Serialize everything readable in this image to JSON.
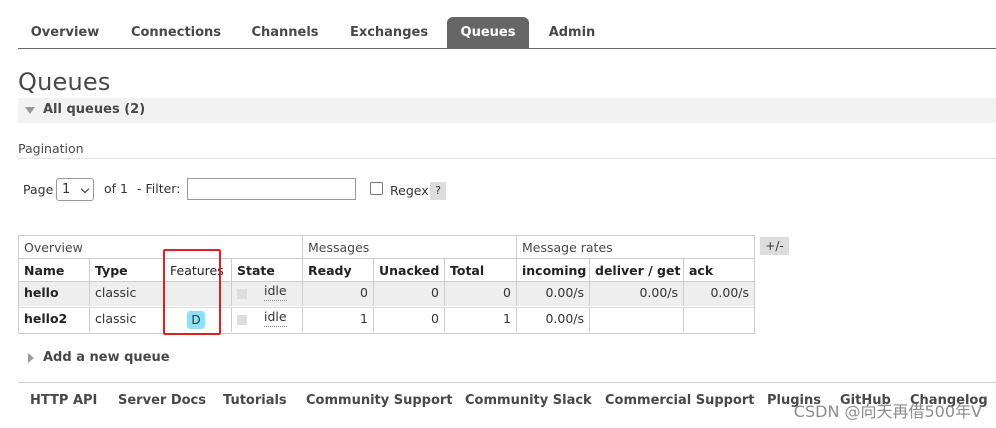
{
  "nav": {
    "tabs": [
      {
        "label": "Overview"
      },
      {
        "label": "Connections"
      },
      {
        "label": "Channels"
      },
      {
        "label": "Exchanges"
      },
      {
        "label": "Queues",
        "active": true
      },
      {
        "label": "Admin"
      }
    ]
  },
  "page": {
    "title": "Queues",
    "section_title": "All queues (2)"
  },
  "pagination": {
    "label": "Pagination",
    "page_label": "Page",
    "page_value": "1",
    "of_label": "of 1",
    "filter_label": "- Filter:",
    "filter_value": "",
    "regex_label": "Regex",
    "help_label": "?"
  },
  "table": {
    "groups": {
      "overview": "Overview",
      "messages": "Messages",
      "rates": "Message rates"
    },
    "columns": {
      "name": "Name",
      "type": "Type",
      "features": "Features",
      "state": "State",
      "ready": "Ready",
      "unacked": "Unacked",
      "total": "Total",
      "incoming": "incoming",
      "deliver_get": "deliver / get",
      "ack": "ack"
    },
    "toggle_label": "+/-",
    "rows": [
      {
        "name": "hello",
        "type": "classic",
        "features": "",
        "state": "idle",
        "ready": "0",
        "unacked": "0",
        "total": "0",
        "incoming": "0.00/s",
        "deliver_get": "0.00/s",
        "ack": "0.00/s"
      },
      {
        "name": "hello2",
        "type": "classic",
        "features": "D",
        "state": "idle",
        "ready": "1",
        "unacked": "0",
        "total": "1",
        "incoming": "0.00/s",
        "deliver_get": "",
        "ack": ""
      }
    ]
  },
  "add_queue": {
    "label": "Add a new queue"
  },
  "footer": {
    "links": [
      "HTTP API",
      "Server Docs",
      "Tutorials",
      "Community Support",
      "Community Slack",
      "Commercial Support",
      "Plugins",
      "GitHub",
      "Changelog"
    ]
  },
  "watermark": "CSDN @向天再借500年V",
  "colors": {
    "active_tab": "#666666",
    "feature_badge": "#8fe0f5",
    "highlight_box": "#e02020"
  }
}
